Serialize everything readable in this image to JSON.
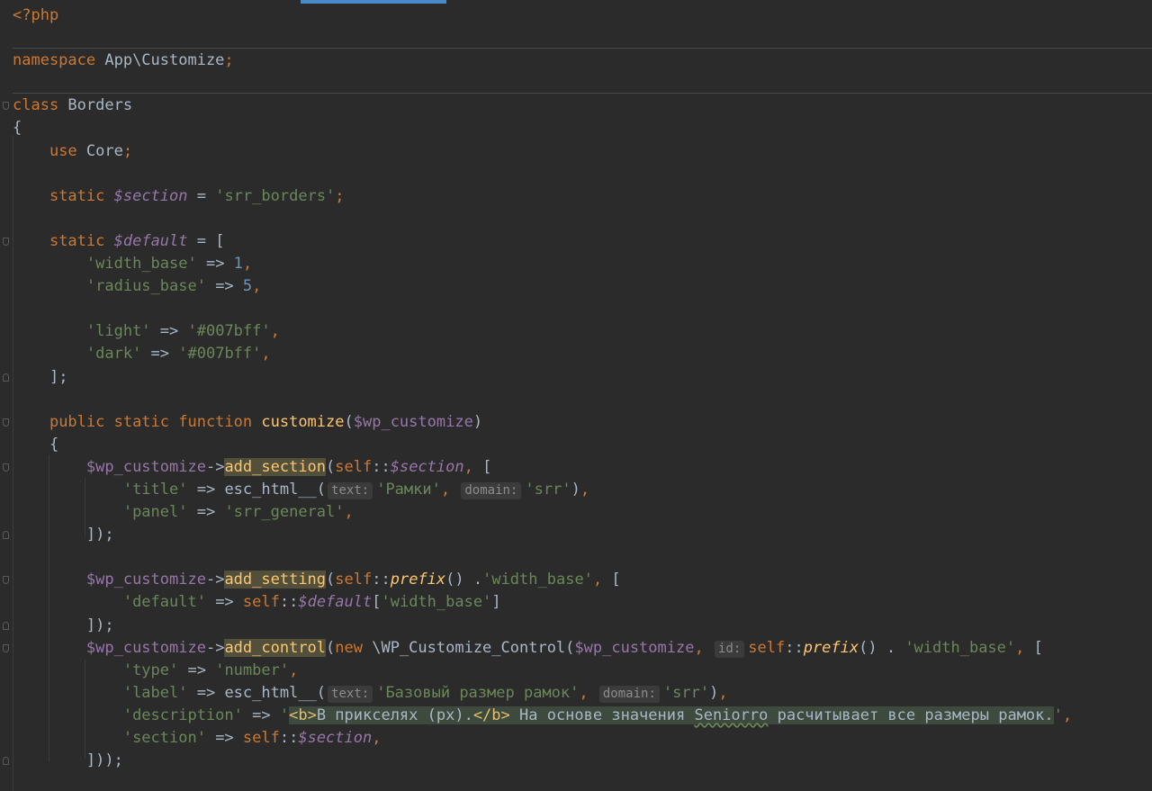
{
  "editor": {
    "language": "PHP",
    "lines": {
      "l1": "<?php",
      "l3_kw": "namespace",
      "l3_name": " App\\Customize",
      "l5_kw": "class",
      "l5_name": " Borders",
      "l6": "{",
      "l7_kw": "use",
      "l7_name": " Core",
      "l9_kw": "static",
      "l9_var": "$section",
      "l9_str": "'srr_borders'",
      "l11_kw": "static",
      "l11_var": "$default",
      "l12_key": "'width_base'",
      "l12_val": "1",
      "l13_key": "'radius_base'",
      "l13_val": "5",
      "l15_key": "'light'",
      "l15_val": "'#007bff'",
      "l16_key": "'dark'",
      "l16_val": "'#007bff'",
      "l17": "];",
      "l19_kw": "public static function",
      "l19_fn": "customize",
      "l19_var": "$wp_customize",
      "l20": "{",
      "l21_var": "$wp_customize",
      "l21_fn": "add_section",
      "l21_self": "self",
      "l21_svar": "$section",
      "l22_key": "'title'",
      "l22_fn": "esc_html__",
      "l22_hint1": "text:",
      "l22_arg1": "'Рамки'",
      "l22_hint2": "domain:",
      "l22_arg2": "'srr'",
      "l23_key": "'panel'",
      "l23_val": "'srr_general'",
      "l24": "]);",
      "l26_var": "$wp_customize",
      "l26_fn": "add_setting",
      "l26_self": "self",
      "l26_prefix": "prefix",
      "l26_str": "'width_base'",
      "l27_key": "'default'",
      "l27_self": "self",
      "l27_var": "$default",
      "l27_str": "'width_base'",
      "l28": "]);",
      "l29_var": "$wp_customize",
      "l29_fn": "add_control",
      "l29_new": "new",
      "l29_class": " \\WP_Customize_Control(",
      "l29_arg": "$wp_customize",
      "l29_hint": "id:",
      "l29_self": "self",
      "l29_prefix": "prefix",
      "l29_str": "'width_base'",
      "l30_key": "'type'",
      "l30_val": "'number'",
      "l31_key": "'label'",
      "l31_fn": "esc_html__",
      "l31_hint1": "text:",
      "l31_arg1": "'Базовый размер рамок'",
      "l31_hint2": "domain:",
      "l31_arg2": "'srr'",
      "l32_key": "'description'",
      "l32_q1": "'",
      "l32_tag1": "<b>",
      "l32_t1": "В прикселях (px).",
      "l32_tag2": "</b>",
      "l32_t2": " На основе значения ",
      "l32_t3": "Seniorro",
      "l32_t4": " расчитывает все размеры рамок.",
      "l32_q2": "'",
      "l33_key": "'section'",
      "l33_self": "self",
      "l33_var": "$section",
      "l34": "]));"
    }
  },
  "colors": {
    "background": "#2b2b2b",
    "keyword": "#cc7832",
    "string": "#6a8759",
    "number": "#6897bb",
    "variable": "#9876aa",
    "function": "#ffc66d",
    "tab_indicator": "#4a88c7"
  }
}
